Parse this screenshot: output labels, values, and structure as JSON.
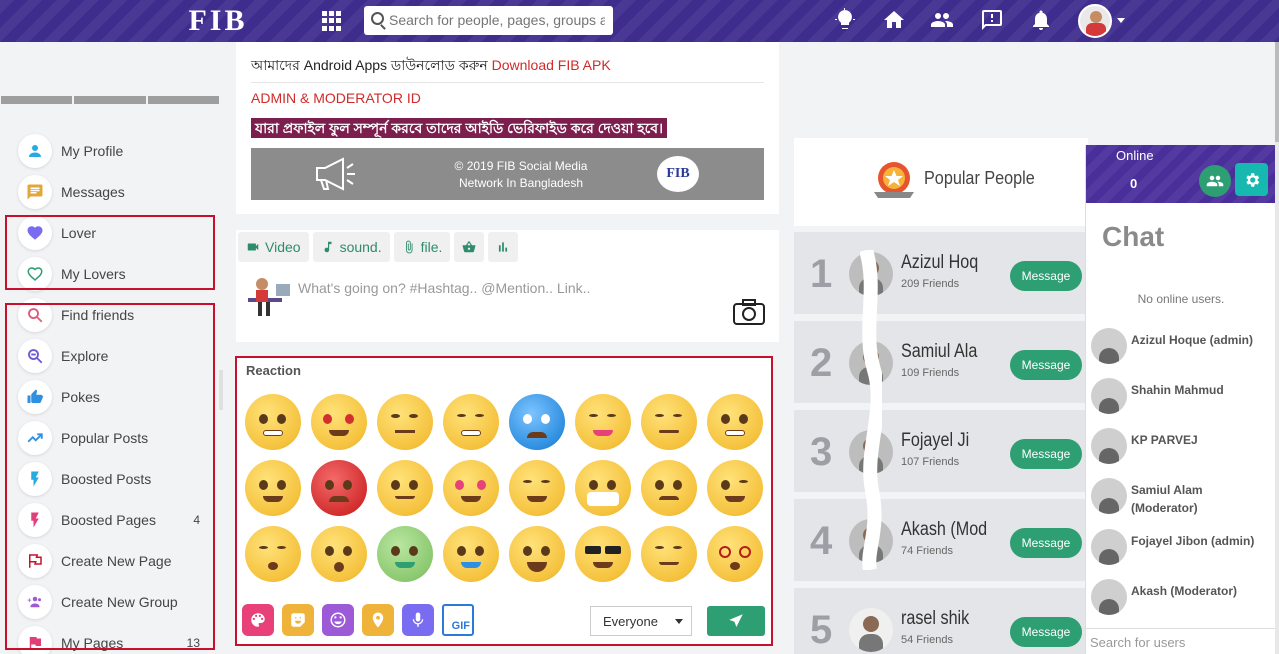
{
  "header": {
    "logo": "FIB",
    "search_placeholder": "Search for people, pages, groups and #hashtags"
  },
  "sidebar": {
    "items": [
      {
        "label": "My Profile",
        "icon": "person-icon",
        "color": "#27a9e1"
      },
      {
        "label": "Messages",
        "icon": "message-icon",
        "color": "#e0a838"
      },
      {
        "label": "Lover",
        "icon": "heart-filled-icon",
        "color": "#7a6cf0"
      },
      {
        "label": "My Lovers",
        "icon": "heart-outline-icon",
        "color": "#2e9e73"
      },
      {
        "label": "Find friends",
        "icon": "search-icon",
        "color": "#e05a7a"
      },
      {
        "label": "Explore",
        "icon": "explore-icon",
        "color": "#6a5ad6"
      },
      {
        "label": "Pokes",
        "icon": "poke-icon",
        "color": "#2f8fe0"
      },
      {
        "label": "Popular Posts",
        "icon": "trending-icon",
        "color": "#2f8fe0"
      },
      {
        "label": "Boosted Posts",
        "icon": "bolt-icon",
        "color": "#27a9e1"
      },
      {
        "label": "Boosted Pages",
        "icon": "bolt-icon",
        "color": "#e0407a",
        "count": "4"
      },
      {
        "label": "Create New Page",
        "icon": "flag-outline-icon",
        "color": "#c8102e"
      },
      {
        "label": "Create New Group",
        "icon": "group-add-icon",
        "color": "#9c5ad6"
      },
      {
        "label": "My Pages",
        "icon": "flag-icon",
        "color": "#e0407a",
        "count": "13"
      }
    ]
  },
  "notice": {
    "line1_text": "আমাদের Android Apps ডাউনলোড করুন ",
    "line1_link": "Download FIB APK",
    "line2": "ADMIN & MODERATOR ID",
    "line3": "যারা প্রফাইল ফুল সম্পূর্ন করবে তাদের আইডি ভেরিফাইড করে দেওয়া হবে।",
    "banner_line1": "© 2019 FIB Social Media",
    "banner_line2": "Network In Bangladesh",
    "banner_logo": "FIB"
  },
  "composer": {
    "tabs": [
      "Video",
      "sound.",
      "file.",
      "",
      ""
    ],
    "placeholder": "What's going on? #Hashtag.. @Mention.. Link.."
  },
  "reaction": {
    "title": "Reaction",
    "privacy": "Everyone",
    "gif_label": "GIF"
  },
  "popular": {
    "title": "Popular People",
    "message_label": "Message",
    "people": [
      {
        "rank": "1",
        "name": "Azizul Hoq",
        "friends": "209 Friends"
      },
      {
        "rank": "2",
        "name": "Samiul Ala",
        "friends": "109 Friends"
      },
      {
        "rank": "3",
        "name": "Fojayel Ji",
        "friends": "107 Friends"
      },
      {
        "rank": "4",
        "name": "Akash (Mod",
        "friends": "74 Friends"
      },
      {
        "rank": "5",
        "name": "rasel shik",
        "friends": "54 Friends"
      }
    ]
  },
  "chat": {
    "online_label": "Online",
    "online_count": "0",
    "title": "Chat",
    "no_users": "No online users.",
    "users": [
      "Azizul Hoque (admin)",
      "Shahin Mahmud",
      "KP PARVEJ",
      "Samiul Alam (Moderator)",
      "Fojayel Jibon (admin)",
      "Akash (Moderator)"
    ],
    "search_placeholder": "Search for users"
  }
}
